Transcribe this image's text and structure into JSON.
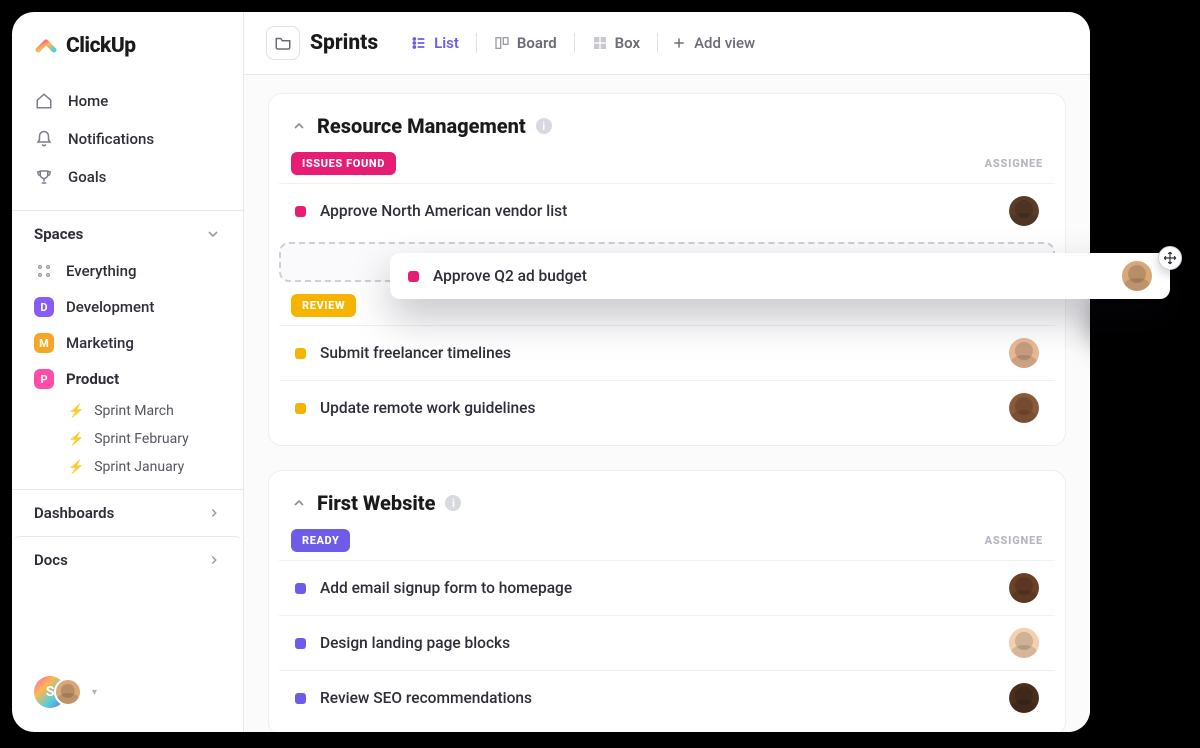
{
  "brand": {
    "name": "ClickUp"
  },
  "sidebar": {
    "nav": [
      {
        "label": "Home"
      },
      {
        "label": "Notifications"
      },
      {
        "label": "Goals"
      }
    ],
    "spaces_header": "Spaces",
    "everything_label": "Everything",
    "spaces": [
      {
        "label": "Development",
        "letter": "D",
        "color": "#8a5cf6"
      },
      {
        "label": "Marketing",
        "letter": "M",
        "color": "#f5a623"
      },
      {
        "label": "Product",
        "letter": "P",
        "color": "#ff4da6"
      }
    ],
    "sprints": [
      {
        "label": "Sprint  March"
      },
      {
        "label": "Sprint  February"
      },
      {
        "label": "Sprint January"
      }
    ],
    "bottom": [
      {
        "label": "Dashboards"
      },
      {
        "label": "Docs"
      }
    ],
    "user_initial": "S"
  },
  "topbar": {
    "title": "Sprints",
    "views": [
      {
        "label": "List",
        "active": true
      },
      {
        "label": "Board",
        "active": false
      },
      {
        "label": "Box",
        "active": false
      }
    ],
    "add_view_label": "Add view"
  },
  "groups": [
    {
      "title": "Resource Management",
      "sections": [
        {
          "status_label": "ISSUES FOUND",
          "status_color": "#e71d73",
          "assignee_header": "ASSIGNEE",
          "tasks": [
            {
              "title": "Approve North American vendor list",
              "dot": "#e71d73",
              "avatar": "skin-1"
            }
          ],
          "has_dropzone": true
        },
        {
          "status_label": "REVIEW",
          "status_color": "#f5b400",
          "tasks": [
            {
              "title": "Submit freelancer timelines",
              "dot": "#f5b400",
              "avatar": "skin-2"
            },
            {
              "title": "Update remote work guidelines",
              "dot": "#f5b400",
              "avatar": "skin-3"
            }
          ]
        }
      ]
    },
    {
      "title": "First Website",
      "sections": [
        {
          "status_label": "READY",
          "status_color": "#6c5ce7",
          "assignee_header": "ASSIGNEE",
          "tasks": [
            {
              "title": "Add email signup form to homepage",
              "dot": "#6c5ce7",
              "avatar": "skin-5"
            },
            {
              "title": "Design landing page blocks",
              "dot": "#6c5ce7",
              "avatar": "skin-6"
            },
            {
              "title": "Review SEO recommendations",
              "dot": "#6c5ce7",
              "avatar": "skin-7"
            }
          ]
        }
      ]
    }
  ],
  "dragging_task": {
    "title": "Approve Q2 ad budget",
    "dot": "#e71d73",
    "avatar": "skin-8"
  }
}
